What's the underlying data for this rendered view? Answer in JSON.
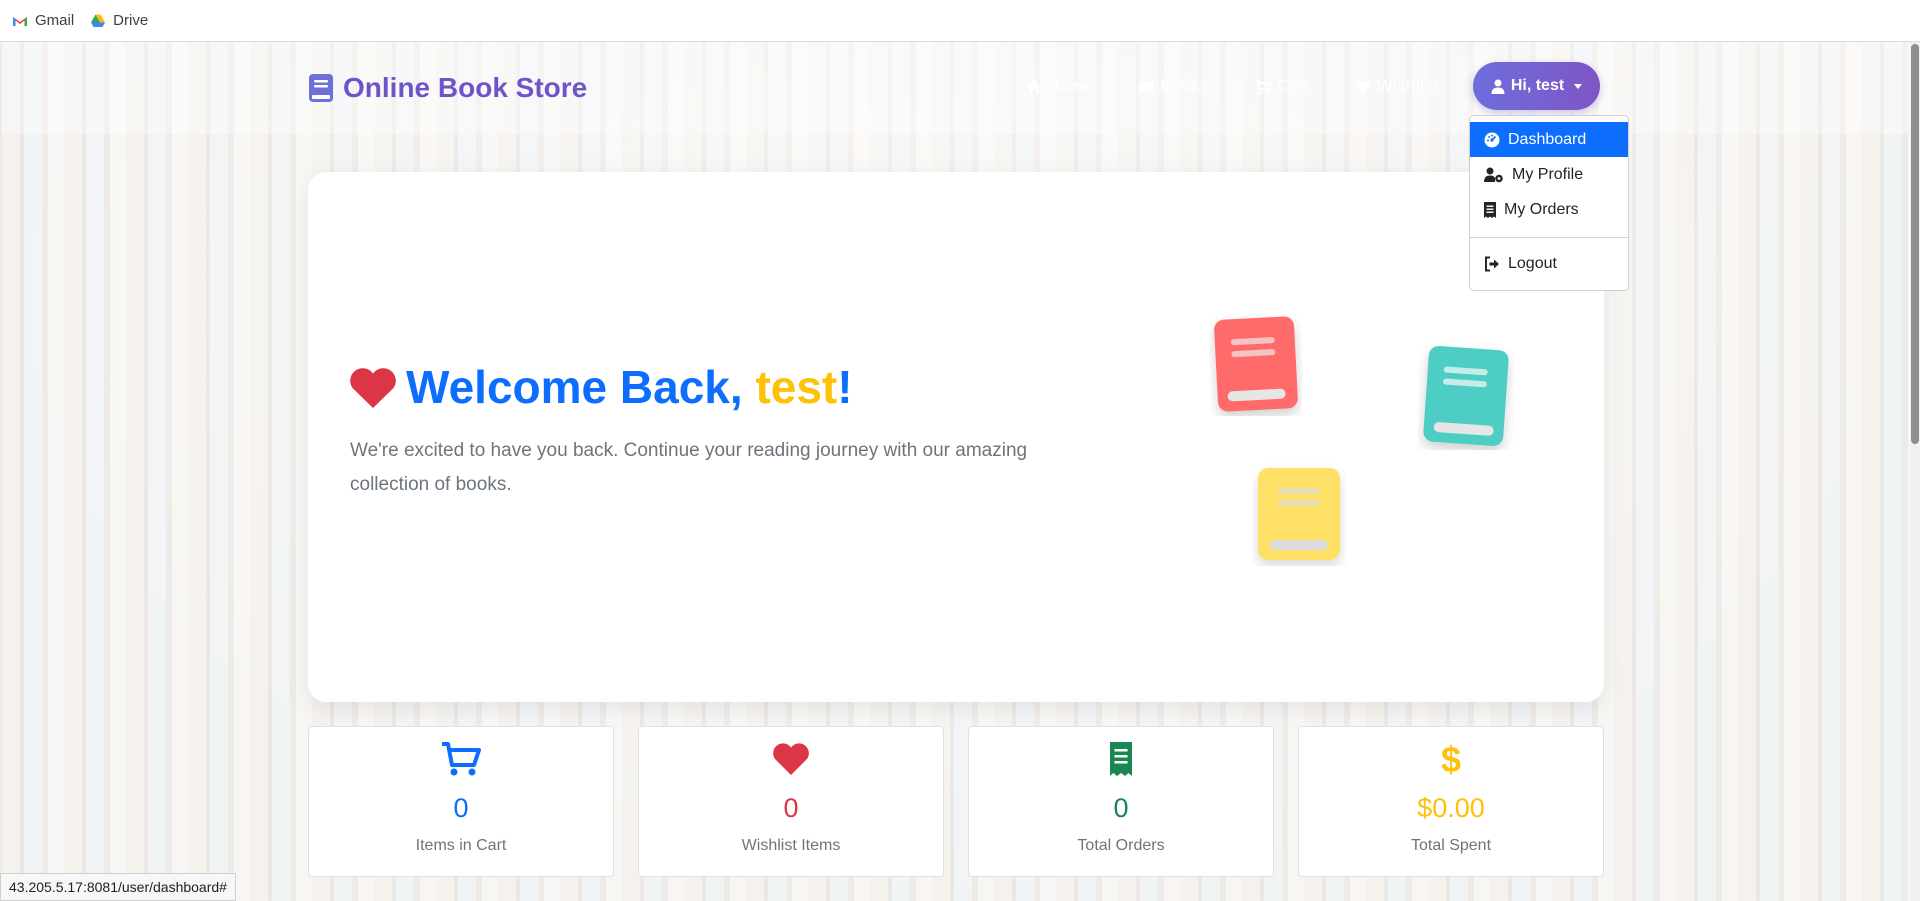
{
  "bookmarks": [
    {
      "label": "Gmail",
      "icon": "gmail-icon"
    },
    {
      "label": "Drive",
      "icon": "drive-icon"
    }
  ],
  "navbar": {
    "brand": "Online Book Store",
    "brand_icon": "book-icon",
    "links": [
      {
        "label": "Home",
        "icon": "home-icon"
      },
      {
        "label": "Books",
        "icon": "open-book-icon"
      },
      {
        "label": "Cart",
        "icon": "cart-icon"
      },
      {
        "label": "Wishlist",
        "icon": "heart-icon"
      }
    ],
    "user_button": "Hi, test"
  },
  "dropdown": {
    "items": [
      {
        "label": "Dashboard",
        "icon": "dashboard-icon",
        "active": true
      },
      {
        "label": "My Profile",
        "icon": "user-cog-icon"
      },
      {
        "label": "My Orders",
        "icon": "receipt-icon"
      },
      {
        "label": "Logout",
        "icon": "logout-icon"
      }
    ]
  },
  "hero": {
    "title_prefix": "Welcome Back, ",
    "title_name": "test",
    "title_suffix": "!",
    "subtitle": "We're excited to have you back. Continue your reading journey with our amazing collection of books."
  },
  "stats": [
    {
      "value": "0",
      "label": "Items in Cart",
      "icon": "cart-icon",
      "color": "#0d6efd"
    },
    {
      "value": "0",
      "label": "Wishlist Items",
      "icon": "heart-icon",
      "color": "#dc3545"
    },
    {
      "value": "0",
      "label": "Total Orders",
      "icon": "receipt-icon",
      "color": "#198754"
    },
    {
      "value": "$0.00",
      "label": "Total Spent",
      "icon": "dollar-icon",
      "color": "#ffc107"
    }
  ],
  "status_url": "43.205.5.17:8081/user/dashboard#",
  "colors": {
    "primary": "#0d6efd",
    "accent_yellow": "#ffc107",
    "danger": "#dc3545",
    "success": "#198754",
    "brand_purple": "#6d55c9",
    "book_red": "#ff6b6b",
    "book_teal": "#4ecdc4",
    "book_yellow": "#ffe066"
  }
}
